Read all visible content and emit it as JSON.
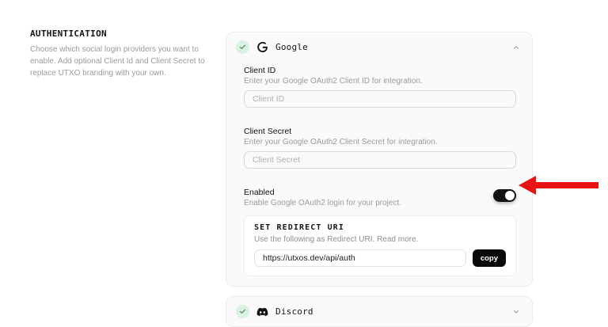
{
  "section": {
    "title": "AUTHENTICATION",
    "description": "Choose which social login providers you want to enable. Add optional Client Id and Client Secret to replace UTXO branding with your own."
  },
  "google": {
    "title": "Google",
    "status_icon": "check-icon",
    "provider_icon": "google-g-icon",
    "expand_icon": "chevron-up-icon",
    "client_id": {
      "label": "Client ID",
      "description": "Enter your Google OAuth2 Client ID for integration.",
      "placeholder": "Client ID",
      "value": ""
    },
    "client_secret": {
      "label": "Client Secret",
      "description": "Enter your Google OAuth2 Client Secret for integration.",
      "placeholder": "Client Secret",
      "value": ""
    },
    "enabled": {
      "label": "Enabled",
      "description": "Enable Google OAuth2 login for your project.",
      "state": "on"
    },
    "redirect": {
      "title": "SET REDIRECT URI",
      "description": "Use the following as Redirect URI.",
      "read_more": "Read more.",
      "value": "https://utxos.dev/api/auth",
      "copy_label": "copy"
    }
  },
  "discord": {
    "title": "Discord",
    "status_icon": "check-icon",
    "provider_icon": "discord-icon",
    "expand_icon": "chevron-down-icon"
  },
  "annotation": {
    "type": "red-arrow-pointing-left-at-enabled-toggle"
  },
  "colors": {
    "badge_bg": "#d9f2e2",
    "badge_check": "#617569",
    "toggle_on": "#141414",
    "copy_bg": "#0a0a0a",
    "arrow": "#ea1313"
  }
}
